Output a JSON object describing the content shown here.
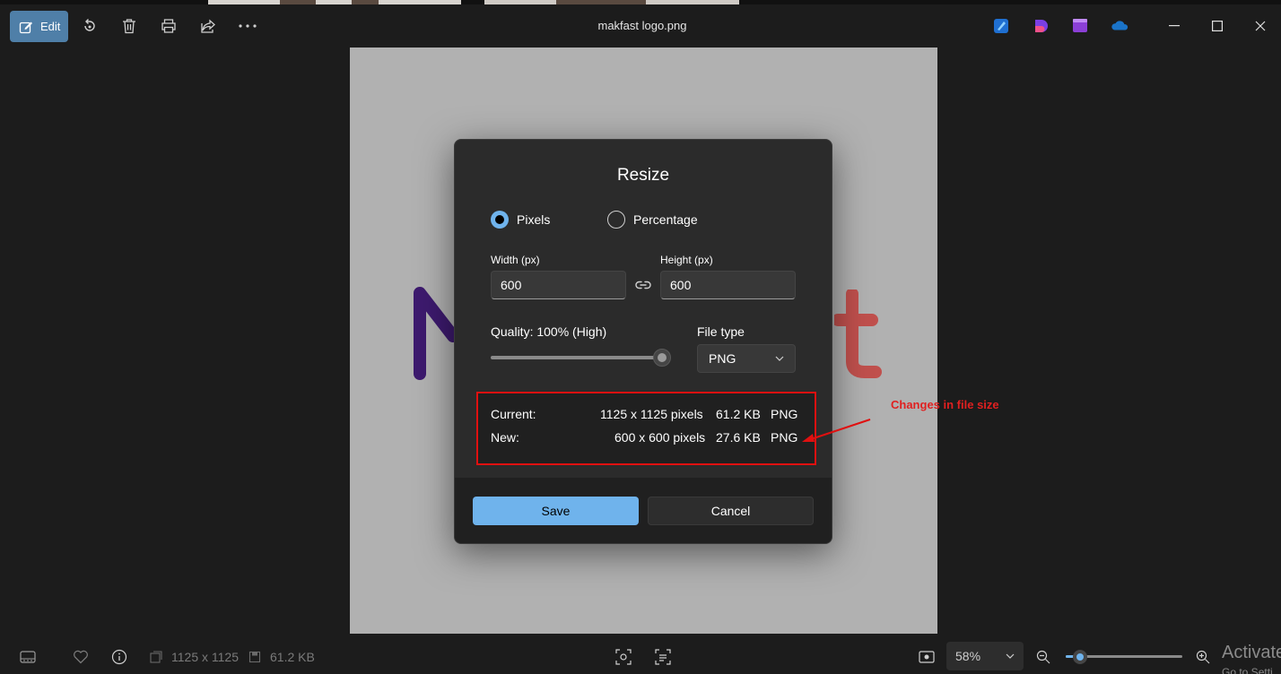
{
  "toolbar": {
    "edit_label": "Edit",
    "file_title": "makfast logo.png"
  },
  "dialog": {
    "title": "Resize",
    "mode_pixels": "Pixels",
    "mode_percentage": "Percentage",
    "selected_mode": "Pixels",
    "width_label": "Width  (px)",
    "width_value": "600",
    "height_label": "Height  (px)",
    "height_value": "600",
    "quality_label": "Quality: 100% (High)",
    "quality_value": 1.0,
    "file_type_label": "File type",
    "file_type_value": "PNG",
    "current": {
      "label": "Current:",
      "dimensions": "1125 x 1125 pixels",
      "size": "61.2 KB",
      "type": "PNG"
    },
    "new": {
      "label": "New:",
      "dimensions": "600 x 600 pixels",
      "size": "27.6 KB",
      "type": "PNG"
    },
    "save_label": "Save",
    "cancel_label": "Cancel"
  },
  "annotation": {
    "text": "Changes in file size",
    "color": "#e01010"
  },
  "statusbar": {
    "dimensions": "1125 x 1125",
    "file_size": "61.2 KB",
    "zoom_value": "58%",
    "zoom_level": 0.12,
    "activate_title": "Activate",
    "activate_sub": "Go to Setti"
  },
  "colors": {
    "accent": "#6fb3ec",
    "edit_button": "#4f7fa8",
    "dialog_bg": "#2b2b2b",
    "image_bg": "#b1b1b1",
    "logo_purple": "#3d1a6e",
    "logo_red": "#c0504d"
  },
  "icons": {
    "edit": "edit-photo-icon",
    "rotate": "rotate-icon",
    "delete": "trash-icon",
    "print": "print-icon",
    "share": "share-icon",
    "more": "more-icon",
    "link": "link-icon",
    "chevron": "chevron-down-icon"
  }
}
